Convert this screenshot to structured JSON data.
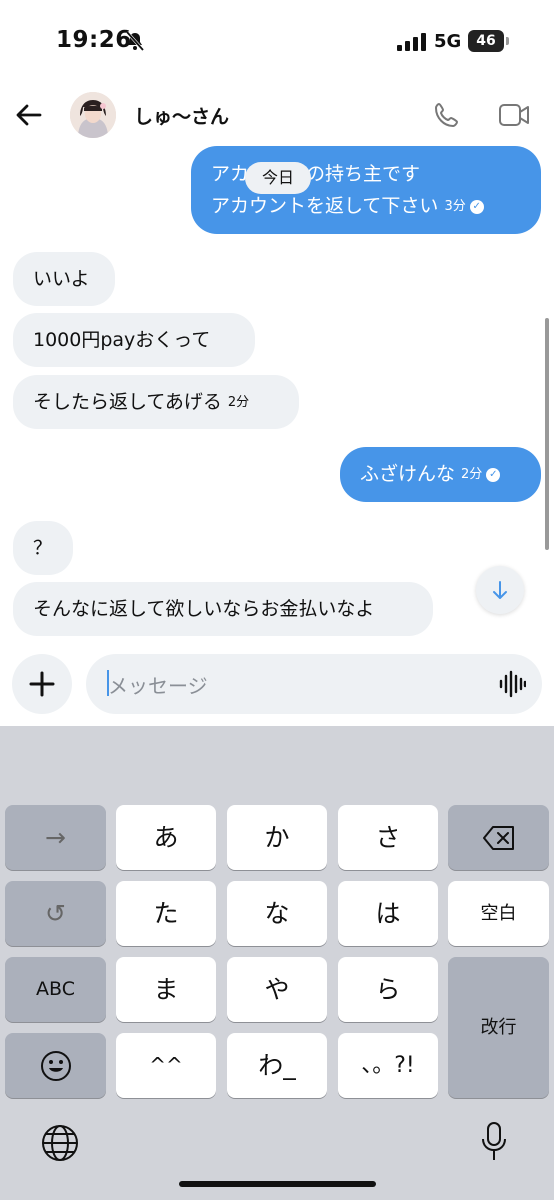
{
  "status_bar": {
    "time": "19:26",
    "network": "5G",
    "battery": "46"
  },
  "header": {
    "contact_name": "しゅ〜さん"
  },
  "date_divider": "今日",
  "messages": [
    {
      "dir": "out",
      "lines": [
        "アカウントの持ち主です",
        "アカウントを返して下さい"
      ],
      "time": "3分"
    },
    {
      "dir": "in",
      "text": "いいよ"
    },
    {
      "dir": "in",
      "text": "1000円payおくって"
    },
    {
      "dir": "in",
      "text": "そしたら返してあげる",
      "time": "2分"
    },
    {
      "dir": "out",
      "text": "ふざけんな",
      "time": "2分"
    },
    {
      "dir": "in",
      "text": "？"
    },
    {
      "dir": "in",
      "text": "そんなに返して欲しいならお金払いなよ"
    }
  ],
  "composer": {
    "placeholder": "メッセージ"
  },
  "keyboard": {
    "rows": [
      [
        "→",
        "あ",
        "か",
        "さ",
        "⌫"
      ],
      [
        "↺",
        "た",
        "な",
        "は",
        "空白"
      ],
      [
        "ABC",
        "ま",
        "や",
        "ら",
        "改行"
      ],
      [
        "☺",
        "^^",
        "わ_",
        "、。?!"
      ]
    ]
  },
  "icons": {
    "accent": "#4795e8"
  }
}
